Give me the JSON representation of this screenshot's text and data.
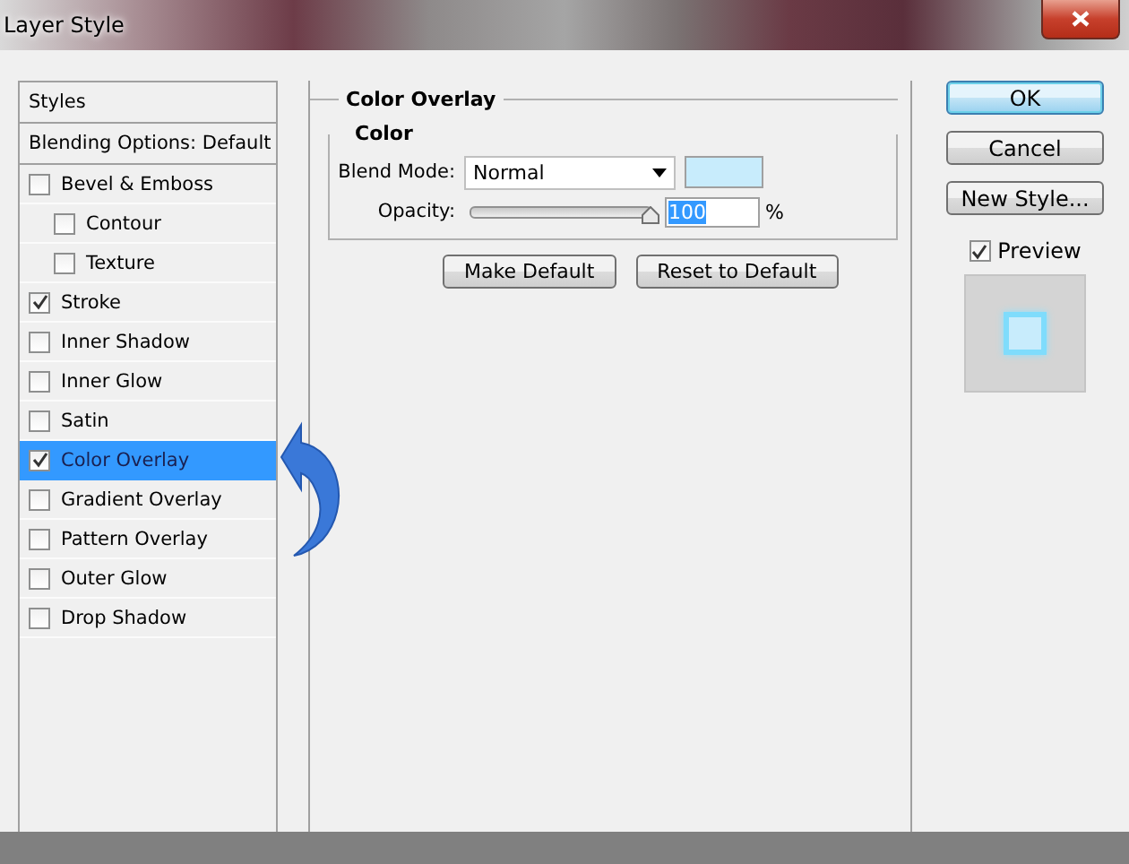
{
  "window": {
    "title": "Layer Style"
  },
  "styles_panel": {
    "header": "Styles",
    "items": [
      {
        "kind": "option",
        "label": "Blending Options: Default",
        "selected": false
      },
      {
        "kind": "effect",
        "label": "Bevel & Emboss",
        "checked": false,
        "selected": false,
        "children": [
          {
            "kind": "effect",
            "label": "Contour",
            "checked": false,
            "selected": false
          },
          {
            "kind": "effect",
            "label": "Texture",
            "checked": false,
            "selected": false
          }
        ]
      },
      {
        "kind": "effect",
        "label": "Stroke",
        "checked": true,
        "selected": false
      },
      {
        "kind": "effect",
        "label": "Inner Shadow",
        "checked": false,
        "selected": false
      },
      {
        "kind": "effect",
        "label": "Inner Glow",
        "checked": false,
        "selected": false
      },
      {
        "kind": "effect",
        "label": "Satin",
        "checked": false,
        "selected": false
      },
      {
        "kind": "effect",
        "label": "Color Overlay",
        "checked": true,
        "selected": true
      },
      {
        "kind": "effect",
        "label": "Gradient Overlay",
        "checked": false,
        "selected": false
      },
      {
        "kind": "effect",
        "label": "Pattern Overlay",
        "checked": false,
        "selected": false
      },
      {
        "kind": "effect",
        "label": "Outer Glow",
        "checked": false,
        "selected": false
      },
      {
        "kind": "effect",
        "label": "Drop Shadow",
        "checked": false,
        "selected": false
      }
    ]
  },
  "color_overlay": {
    "title": "Color Overlay",
    "group": "Color",
    "blend_mode": {
      "label": "Blend Mode:",
      "value": "Normal",
      "color": "#c8ecfc"
    },
    "opacity": {
      "label": "Opacity:",
      "level": 1.0,
      "value": "100",
      "unit": "%"
    },
    "buttons": [
      "Make Default",
      "Reset to Default"
    ]
  },
  "actions": {
    "buttons": [
      {
        "label": "OK",
        "kind": "default"
      },
      {
        "label": "Cancel",
        "kind": "normal"
      },
      {
        "label": "New Style...",
        "kind": "normal"
      }
    ],
    "preview": {
      "label": "Preview",
      "checked": true
    }
  }
}
